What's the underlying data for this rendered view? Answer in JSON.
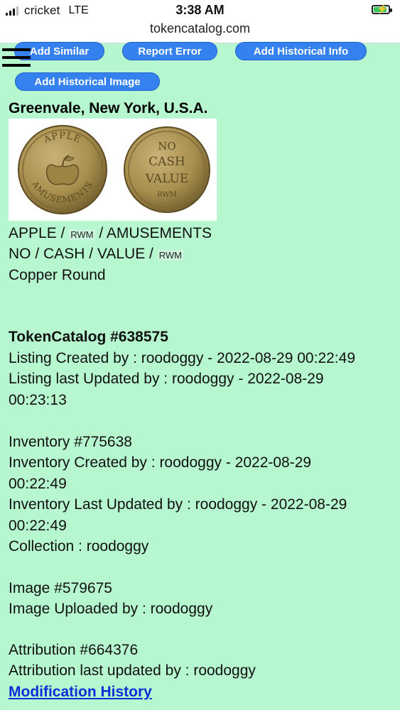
{
  "status_bar": {
    "carrier": "cricket",
    "network": "LTE",
    "time": "3:38 AM",
    "url": "tokencatalog.com",
    "signal_bars": 3,
    "battery_level": 0.75
  },
  "actions": {
    "add_similar": "Add Similar",
    "report_error": "Report Error",
    "add_historical_info": "Add Historical Info",
    "add_historical_image": "Add Historical Image"
  },
  "token": {
    "location": "Greenvale, New York, U.S.A.",
    "obverse": {
      "words": [
        "APPLE",
        "RWM",
        "AMUSEMENTS"
      ],
      "coin_legend_top": "APPLE",
      "coin_legend_bottom": "AMUSEMENTS"
    },
    "reverse": {
      "words": [
        "NO",
        "CASH",
        "VALUE",
        "RWM"
      ],
      "coin_legend": [
        "NO",
        "CASH",
        "VALUE",
        "RWM"
      ]
    },
    "separator": " / ",
    "material_shape": "Copper Round"
  },
  "catalog": {
    "heading": "TokenCatalog #638575",
    "listing_created": "Listing Created by : roodoggy - 2022-08-29 00:22:49",
    "listing_updated_1": "Listing last Updated by : roodoggy - 2022-08-29",
    "listing_updated_2": "00:23:13",
    "inventory": "Inventory #775638",
    "inventory_created_1": "Inventory Created by : roodoggy - 2022-08-29",
    "inventory_created_2": "00:22:49",
    "inventory_updated_1": "Inventory Last Updated by : roodoggy - 2022-08-29",
    "inventory_updated_2": "00:22:49",
    "collection": "Collection : roodoggy",
    "image": "Image #579675",
    "image_uploaded": "Image Uploaded by : roodoggy",
    "attribution": "Attribution #664376",
    "attribution_updated": "Attribution last updated by : roodoggy",
    "modification_history": "Modification History"
  },
  "colors": {
    "page_background": "#b6f7cf",
    "button": "#3581f0",
    "link": "#0a2fd6",
    "coin": "#a88f4e"
  }
}
